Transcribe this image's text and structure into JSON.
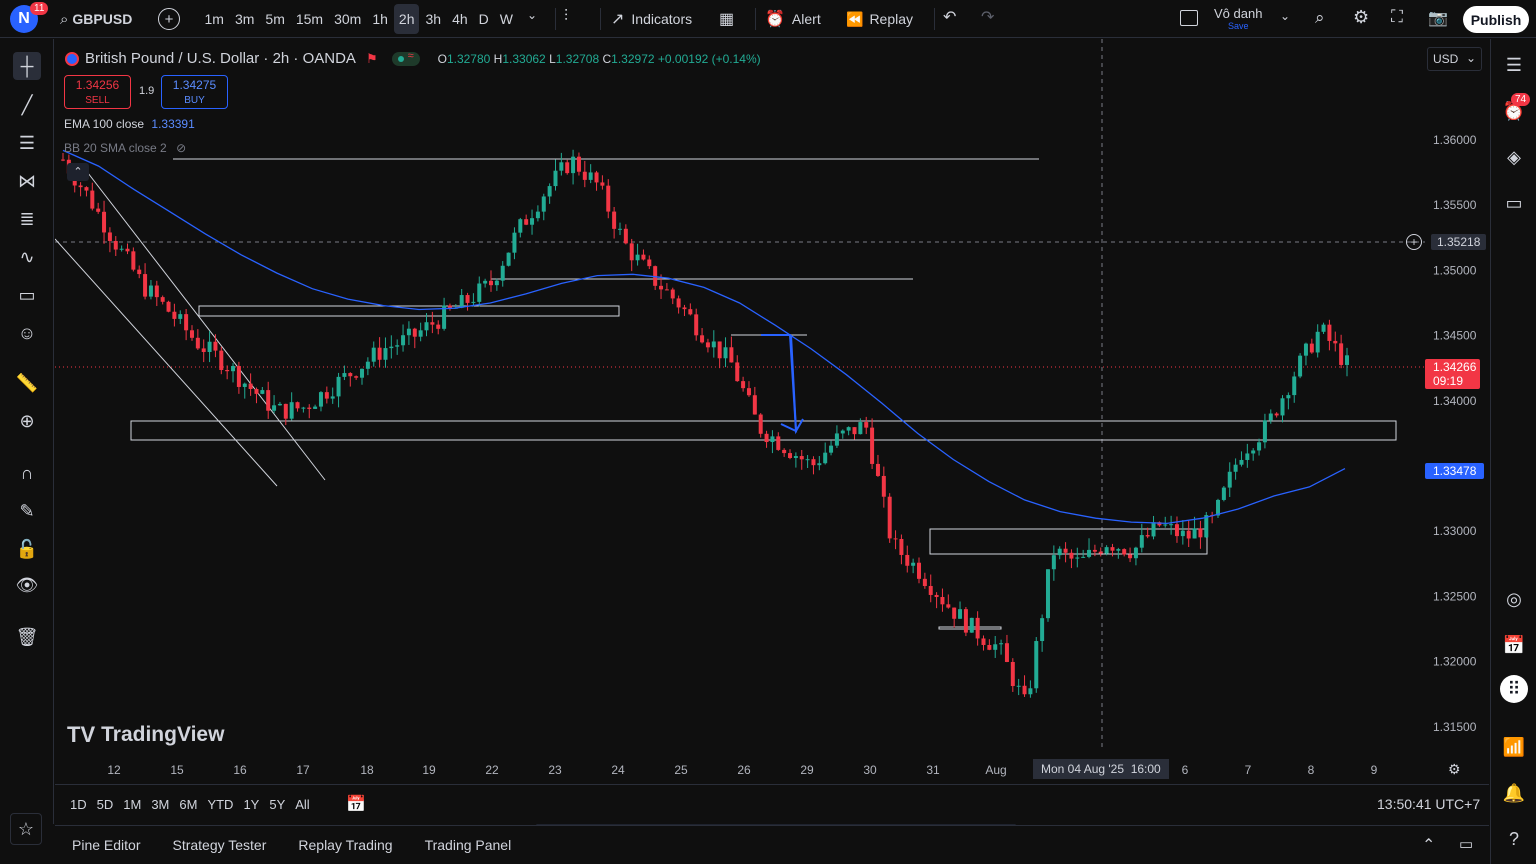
{
  "topbar": {
    "avatar_letter": "N",
    "notification_count": "11",
    "symbol": "GBPUSD",
    "timeframes": [
      "1m",
      "3m",
      "5m",
      "15m",
      "30m",
      "1h",
      "2h",
      "3h",
      "4h",
      "D",
      "W"
    ],
    "active_timeframe": "2h",
    "indicators_label": "Indicators",
    "alert_label": "Alert",
    "replay_label": "Replay",
    "layout_name": "Vô danh",
    "layout_save": "Save",
    "publish_label": "Publish"
  },
  "legend": {
    "title": "British Pound / U.S. Dollar · 2h · OANDA",
    "open_label": "O",
    "open": "1.32780",
    "high_label": "H",
    "high": "1.33062",
    "low_label": "L",
    "low": "1.32708",
    "close_label": "C",
    "close": "1.32972",
    "change": "+0.00192 (+0.14%)",
    "sell_price": "1.34256",
    "sell_label": "SELL",
    "spread": "1.9",
    "buy_price": "1.34275",
    "buy_label": "BUY",
    "ema": "EMA 100 close",
    "ema_value": "1.33391",
    "bb": "BB 20 SMA close 2"
  },
  "price_axis": {
    "currency": "USD",
    "crosshair_price": "1.35218",
    "current_price": "1.34266",
    "countdown": "09:19",
    "ema_price": "1.33478",
    "accent_red": "#f23645",
    "accent_blue": "#2962ff"
  },
  "date_axis": {
    "crosshair_label": "Mon 04 Aug '25",
    "crosshair_time": "16:00"
  },
  "watermark": "TradingView",
  "bottom": {
    "ranges": [
      "1D",
      "5D",
      "1M",
      "3M",
      "6M",
      "YTD",
      "1Y",
      "5Y",
      "All"
    ],
    "clock": "13:50:41 UTC+7"
  },
  "panel_tabs": [
    "Pine Editor",
    "Strategy Tester",
    "Replay Trading",
    "Trading Panel"
  ],
  "rightbar": {
    "alerts_badge": "74"
  },
  "chart_data": {
    "type": "candlestick",
    "symbol": "GBPUSD",
    "interval": "2h",
    "y_ticks": [
      1.36,
      1.355,
      1.35,
      1.345,
      1.34,
      1.335,
      1.33,
      1.325,
      1.32,
      1.315
    ],
    "y_tick_labels": [
      "1.36000",
      "1.35500",
      "1.35000",
      "1.34500",
      "1.34000",
      "1.33000",
      "1.32500",
      "1.32000",
      "1.31500"
    ],
    "ylim": [
      1.3105,
      1.3638
    ],
    "x_ticks": [
      "12",
      "15",
      "16",
      "17",
      "18",
      "19",
      "22",
      "23",
      "24",
      "25",
      "26",
      "29",
      "30",
      "31",
      "Aug",
      "6",
      "7",
      "8",
      "9"
    ],
    "close_path": [
      1.3585,
      1.3555,
      1.352,
      1.3488,
      1.3468,
      1.3445,
      1.343,
      1.341,
      1.3392,
      1.3395,
      1.341,
      1.3425,
      1.344,
      1.3448,
      1.3462,
      1.3475,
      1.349,
      1.353,
      1.356,
      1.3585,
      1.3565,
      1.352,
      1.3495,
      1.3475,
      1.345,
      1.3428,
      1.338,
      1.3365,
      1.335,
      1.3372,
      1.3382,
      1.329,
      1.327,
      1.3245,
      1.3225,
      1.321,
      1.3165,
      1.3285,
      1.3275,
      1.3292,
      1.3285,
      1.3305,
      1.3295,
      1.3308,
      1.336,
      1.338,
      1.342,
      1.3455,
      1.3428
    ],
    "ema100_path": [
      1.3592,
      1.358,
      1.3562,
      1.3545,
      1.3528,
      1.3512,
      1.3498,
      1.3486,
      1.3478,
      1.3473,
      1.347,
      1.3471,
      1.3475,
      1.3482,
      1.349,
      1.3496,
      1.3497,
      1.3494,
      1.3487,
      1.3475,
      1.3458,
      1.344,
      1.342,
      1.3398,
      1.3375,
      1.3355,
      1.3338,
      1.3324,
      1.3315,
      1.331,
      1.3307,
      1.3306,
      1.331,
      1.3317,
      1.3327,
      1.3334,
      1.3348
    ]
  }
}
